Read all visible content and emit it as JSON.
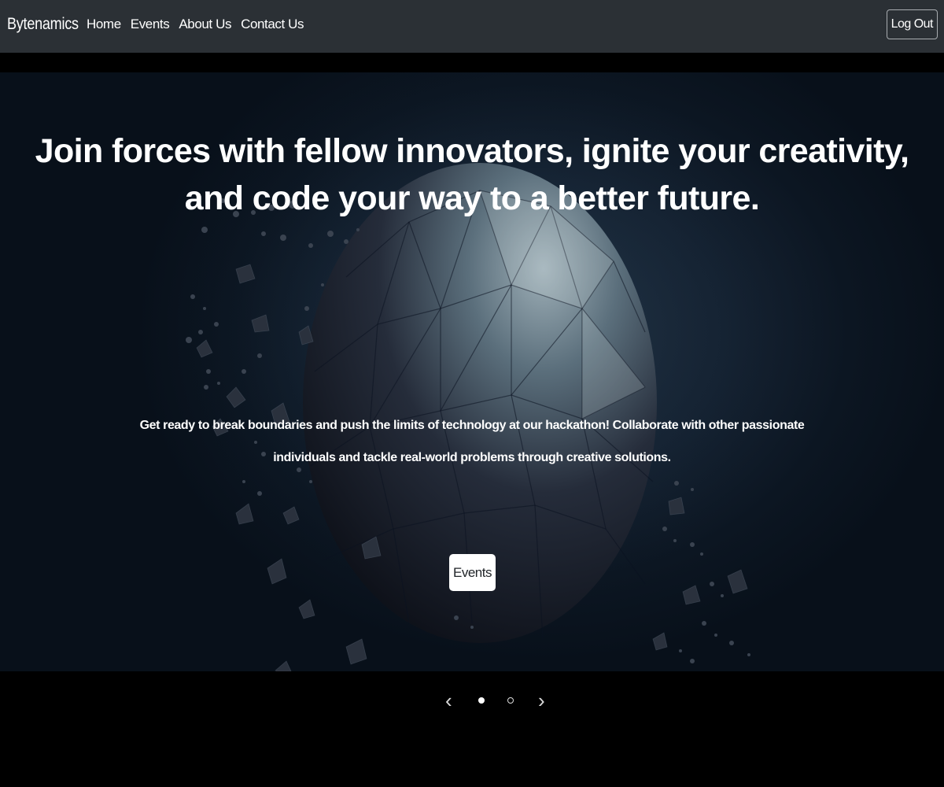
{
  "navbar": {
    "brand": "Bytenamics",
    "links": [
      {
        "label": "Home"
      },
      {
        "label": "Events"
      },
      {
        "label": "About Us"
      },
      {
        "label": "Contact Us"
      }
    ],
    "logout_label": "Log Out"
  },
  "hero": {
    "title": "Join forces with fellow innovators, ignite your creativity, and code your way to a better future.",
    "text": "Get ready to break boundaries and push the limits of technology at our hackathon! Collaborate with other passionate individuals and tackle real-world problems through creative solutions.",
    "button_label": "Events"
  },
  "carousel": {
    "prev_icon": "chevron-left-icon",
    "next_icon": "chevron-right-icon",
    "slide_count": 2,
    "active_index": 0
  },
  "colors": {
    "navbar_bg": "#2b3035",
    "page_bg": "#000000",
    "hero_text": "#ffffff"
  }
}
